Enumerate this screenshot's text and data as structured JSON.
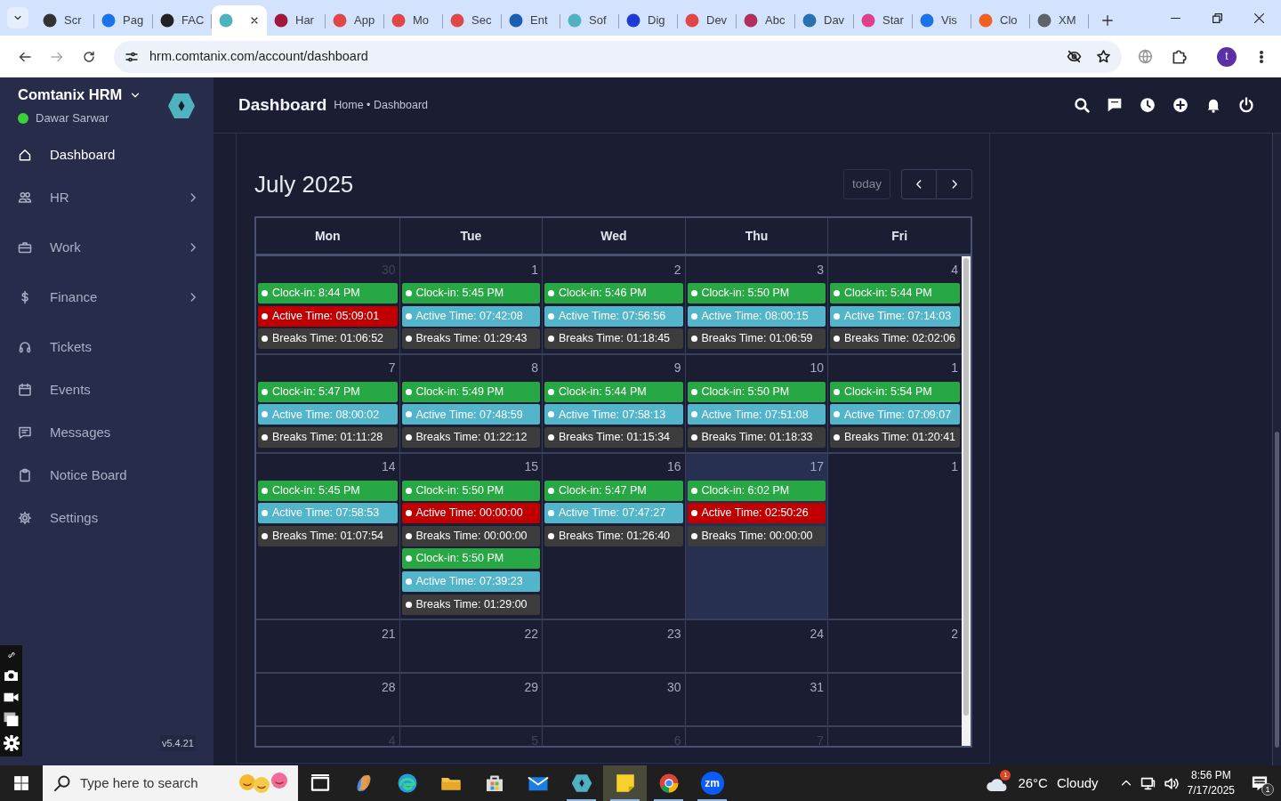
{
  "browser": {
    "tabs": [
      {
        "label": "Scr",
        "color": "#333333",
        "selected": false
      },
      {
        "label": "Pag",
        "color": "#1a73e8",
        "selected": false
      },
      {
        "label": "FAC",
        "color": "#222222",
        "selected": false
      },
      {
        "color": "#4fb3bf",
        "selected": true
      },
      {
        "label": "Har",
        "color": "#a0183a",
        "selected": false
      },
      {
        "label": "App",
        "color": "#e04848",
        "selected": false
      },
      {
        "label": "Mo",
        "color": "#e04848",
        "selected": false
      },
      {
        "label": "Sec",
        "color": "#e04848",
        "selected": false
      },
      {
        "label": "Ent",
        "color": "#1a5fb4",
        "selected": false
      },
      {
        "label": "Sof",
        "color": "#4fb3bf",
        "selected": false
      },
      {
        "label": "Dig",
        "color": "#1f3bd1",
        "selected": false
      },
      {
        "label": "Dev",
        "color": "#e04848",
        "selected": false
      },
      {
        "label": "Abc",
        "color": "#b0305a",
        "selected": false
      },
      {
        "label": "Dav",
        "color": "#2a6fb0",
        "selected": false
      },
      {
        "label": "Star",
        "color": "#e0408a",
        "selected": false
      },
      {
        "label": "Vis",
        "color": "#1a73e8",
        "selected": false
      },
      {
        "label": "Clo",
        "color": "#f06020",
        "selected": false
      },
      {
        "label": "XM",
        "color": "#5f6368",
        "selected": false
      }
    ],
    "address": "hrm.comtanix.com/account/dashboard",
    "profile": "t"
  },
  "sidebar": {
    "brand": "Comtanix HRM",
    "user": "Dawar Sarwar",
    "online": true,
    "items": [
      {
        "label": "Dashboard",
        "selected": true,
        "expandable": false
      },
      {
        "label": "HR",
        "selected": false,
        "expandable": true
      },
      {
        "label": "Work",
        "selected": false,
        "expandable": true
      },
      {
        "label": "Finance",
        "selected": false,
        "expandable": true
      },
      {
        "label": "Tickets",
        "selected": false,
        "expandable": false
      },
      {
        "label": "Events",
        "selected": false,
        "expandable": false
      },
      {
        "label": "Messages",
        "selected": false,
        "expandable": false
      },
      {
        "label": "Notice Board",
        "selected": false,
        "expandable": false
      },
      {
        "label": "Settings",
        "selected": false,
        "expandable": false
      }
    ],
    "version": "v5.4.21"
  },
  "header": {
    "title": "Dashboard",
    "breadcrumb": "Home • Dashboard"
  },
  "calendar": {
    "title": "July 2025",
    "today_button": {
      "label": "today",
      "disabled": true
    },
    "weekdays": [
      "Mon",
      "Tue",
      "Wed",
      "Thu",
      "Fri"
    ],
    "weeks": [
      {
        "days": [
          {
            "number": "30",
            "other_month": true,
            "today": false,
            "events": [
              {
                "text": "Clock-in: 8:44 PM",
                "color": "#28a745"
              },
              {
                "text": "Active Time: 05:09:01",
                "color": "#c00000"
              },
              {
                "text": "Breaks Time: 01:06:52",
                "color": "#3c3c3c"
              }
            ]
          },
          {
            "number": "1",
            "other_month": false,
            "today": false,
            "events": [
              {
                "text": "Clock-in: 5:45 PM",
                "color": "#28a745"
              },
              {
                "text": "Active Time: 07:42:08",
                "color": "#52b5c9"
              },
              {
                "text": "Breaks Time: 01:29:43",
                "color": "#3c3c3c"
              }
            ]
          },
          {
            "number": "2",
            "other_month": false,
            "today": false,
            "events": [
              {
                "text": "Clock-in: 5:46 PM",
                "color": "#28a745"
              },
              {
                "text": "Active Time: 07:56:56",
                "color": "#52b5c9"
              },
              {
                "text": "Breaks Time: 01:18:45",
                "color": "#3c3c3c"
              }
            ]
          },
          {
            "number": "3",
            "other_month": false,
            "today": false,
            "events": [
              {
                "text": "Clock-in: 5:50 PM",
                "color": "#28a745"
              },
              {
                "text": "Active Time: 08:00:15",
                "color": "#52b5c9"
              },
              {
                "text": "Breaks Time: 01:06:59",
                "color": "#3c3c3c"
              }
            ]
          },
          {
            "number": "4",
            "other_month": false,
            "today": false,
            "events": [
              {
                "text": "Clock-in: 5:44 PM",
                "color": "#28a745"
              },
              {
                "text": "Active Time: 07:14:03",
                "color": "#52b5c9"
              },
              {
                "text": "Breaks Time: 02:02:06",
                "color": "#3c3c3c"
              }
            ]
          }
        ]
      },
      {
        "days": [
          {
            "number": "7",
            "other_month": false,
            "today": false,
            "events": [
              {
                "text": "Clock-in: 5:47 PM",
                "color": "#28a745"
              },
              {
                "text": "Active Time: 08:00:02",
                "color": "#52b5c9"
              },
              {
                "text": "Breaks Time: 01:11:28",
                "color": "#3c3c3c"
              }
            ]
          },
          {
            "number": "8",
            "other_month": false,
            "today": false,
            "events": [
              {
                "text": "Clock-in: 5:49 PM",
                "color": "#28a745"
              },
              {
                "text": "Active Time: 07:48:59",
                "color": "#52b5c9"
              },
              {
                "text": "Breaks Time: 01:22:12",
                "color": "#3c3c3c"
              }
            ]
          },
          {
            "number": "9",
            "other_month": false,
            "today": false,
            "events": [
              {
                "text": "Clock-in: 5:44 PM",
                "color": "#28a745"
              },
              {
                "text": "Active Time: 07:58:13",
                "color": "#52b5c9"
              },
              {
                "text": "Breaks Time: 01:15:34",
                "color": "#3c3c3c"
              }
            ]
          },
          {
            "number": "10",
            "other_month": false,
            "today": false,
            "events": [
              {
                "text": "Clock-in: 5:50 PM",
                "color": "#28a745"
              },
              {
                "text": "Active Time: 07:51:08",
                "color": "#52b5c9"
              },
              {
                "text": "Breaks Time: 01:18:33",
                "color": "#3c3c3c"
              }
            ]
          },
          {
            "number": "1",
            "other_month": false,
            "today": false,
            "events": [
              {
                "text": "Clock-in: 5:54 PM",
                "color": "#28a745"
              },
              {
                "text": "Active Time: 07:09:07",
                "color": "#52b5c9"
              },
              {
                "text": "Breaks Time: 01:20:41",
                "color": "#3c3c3c"
              }
            ]
          }
        ]
      },
      {
        "days": [
          {
            "number": "14",
            "other_month": false,
            "today": false,
            "events": [
              {
                "text": "Clock-in: 5:45 PM",
                "color": "#28a745"
              },
              {
                "text": "Active Time: 07:58:53",
                "color": "#52b5c9"
              },
              {
                "text": "Breaks Time: 01:07:54",
                "color": "#3c3c3c"
              }
            ]
          },
          {
            "number": "15",
            "other_month": false,
            "today": false,
            "events": [
              {
                "text": "Clock-in: 5:50 PM",
                "color": "#28a745"
              },
              {
                "text": "Active Time: 00:00:00",
                "color": "#c00000"
              },
              {
                "text": "Breaks Time: 00:00:00",
                "color": "#3c3c3c"
              },
              {
                "text": "Clock-in: 5:50 PM",
                "color": "#28a745"
              },
              {
                "text": "Active Time: 07:39:23",
                "color": "#52b5c9"
              },
              {
                "text": "Breaks Time: 01:29:00",
                "color": "#3c3c3c"
              }
            ]
          },
          {
            "number": "16",
            "other_month": false,
            "today": false,
            "events": [
              {
                "text": "Clock-in: 5:47 PM",
                "color": "#28a745"
              },
              {
                "text": "Active Time: 07:47:27",
                "color": "#52b5c9"
              },
              {
                "text": "Breaks Time: 01:26:40",
                "color": "#3c3c3c"
              }
            ]
          },
          {
            "number": "17",
            "other_month": false,
            "today": true,
            "events": [
              {
                "text": "Clock-in: 6:02 PM",
                "color": "#28a745"
              },
              {
                "text": "Active Time: 02:50:26",
                "color": "#c00000"
              },
              {
                "text": "Breaks Time: 00:00:00",
                "color": "#3c3c3c"
              }
            ]
          },
          {
            "number": "1",
            "other_month": false,
            "today": false
          }
        ]
      },
      {
        "days": [
          {
            "number": "21",
            "other_month": false,
            "today": false
          },
          {
            "number": "22",
            "other_month": false,
            "today": false
          },
          {
            "number": "23",
            "other_month": false,
            "today": false
          },
          {
            "number": "24",
            "other_month": false,
            "today": false
          },
          {
            "number": "2",
            "other_month": false,
            "today": false
          }
        ]
      },
      {
        "days": [
          {
            "number": "28",
            "other_month": false,
            "today": false
          },
          {
            "number": "29",
            "other_month": false,
            "today": false
          },
          {
            "number": "30",
            "other_month": false,
            "today": false
          },
          {
            "number": "31",
            "other_month": false,
            "today": false
          },
          {
            "today": false
          }
        ]
      },
      {
        "days": [
          {
            "number": "4",
            "other_month": true,
            "today": false
          },
          {
            "number": "5",
            "other_month": true,
            "today": false
          },
          {
            "number": "6",
            "other_month": true,
            "today": false
          },
          {
            "number": "7",
            "other_month": true,
            "today": false
          },
          {
            "today": false
          }
        ]
      }
    ]
  },
  "taskbar": {
    "search": {
      "placeholder": "Type here to search"
    },
    "apps": [
      {
        "running": false,
        "selected": false
      },
      {
        "running": false,
        "selected": false
      },
      {
        "running": false,
        "selected": false
      },
      {
        "running": false,
        "selected": false
      },
      {
        "running": false,
        "selected": false
      },
      {
        "running": false,
        "selected": false
      },
      {
        "running": true,
        "selected": false
      },
      {
        "running": true,
        "selected": true
      },
      {
        "running": true,
        "selected": false
      },
      {
        "running": true,
        "selected": false,
        "label": "zm"
      }
    ],
    "weather": {
      "badge": "1",
      "temperature": "26°C",
      "condition": "Cloudy"
    },
    "time": "8:56 PM",
    "date": "7/17/2025",
    "notifications": "1"
  }
}
